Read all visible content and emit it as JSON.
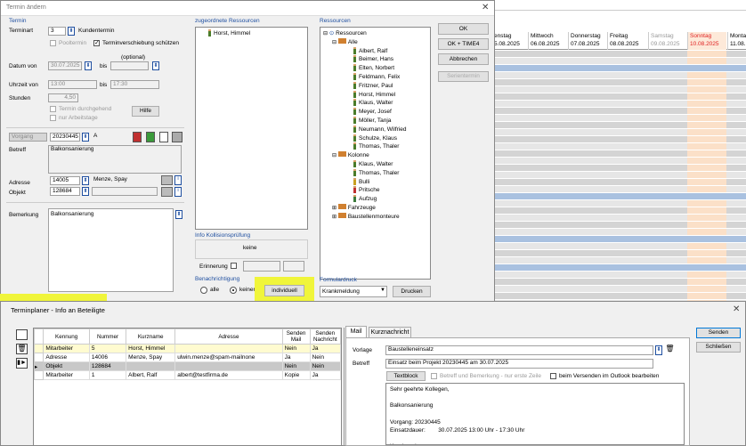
{
  "termin_dialog": {
    "title": "Termin ändern",
    "section_termin": "Termin",
    "terminart_label": "Terminart",
    "terminart_value": "3",
    "terminart_text": "Kundentermin",
    "pooltermin_label": "Pooltermin",
    "verschiebung_label": "Terminverschiebung schützen",
    "optional_label": "(optional)",
    "datum_von_label": "Datum von",
    "datum_von_value": "30.07.2025",
    "bis_label": "bis",
    "uhrzeit_label": "Uhrzeit von",
    "uhrzeit_von": "13:00",
    "uhrzeit_bis": "17:30",
    "stunden_label": "Stunden",
    "stunden_value": "4,50",
    "durchgehend_label": "Termin durchgehend",
    "arbeitstage_label": "nur Arbeitstage",
    "hilfe_label": "Hilfe",
    "vorgang_label": "Vorgang",
    "vorgang_value": "20230445",
    "vorgang_suffix": "A",
    "betreff_label": "Betreff",
    "betreff_value": "Balkonsanierung",
    "adresse_label": "Adresse",
    "adresse_value": "14005",
    "adresse_name": "Menze, Spay",
    "objekt_label": "Objekt",
    "objekt_value": "128684",
    "bemerkung_label": "Bemerkung",
    "bemerkung_value": "Balkonsanierung"
  },
  "zugeordnet": {
    "title": "zugeordnete Ressourcen",
    "items": [
      "Horst, Himmel"
    ]
  },
  "kollision": {
    "title": "Info Kollisionsprüfung",
    "value": "keine"
  },
  "erinnerung_label": "Erinnerung",
  "benachrichtigung": {
    "title": "Benachrichtigung",
    "opt_alle": "alle",
    "opt_keiner": "keiner",
    "individuell": "individuell"
  },
  "ressourcen": {
    "title": "Ressourcen",
    "root": "Ressourcen",
    "alle": "Alle",
    "alle_items": [
      "Albert, Ralf",
      "Beimer, Hans",
      "Elten, Norbert",
      "Feldmann, Felix",
      "Fritzner, Paul",
      "Horst, Himmel",
      "Klaus, Walter",
      "Meyer, Josef",
      "Möller, Tanja",
      "Neumann, Wilfried",
      "Schulze, Klaus",
      "Thomas, Thaler"
    ],
    "kolonne": "Kolonne",
    "kolonne_items": [
      "Klaus, Walter",
      "Thomas, Thaler",
      "Bulli",
      "Pritsche",
      "Aufzug"
    ],
    "fahrzeuge": "Fahrzeuge",
    "baustellenmonteure": "Baustellenmonteure"
  },
  "formulardruck": {
    "title": "Formulardruck",
    "select": "Krankmeldung",
    "drucken": "Drucken"
  },
  "side_buttons": {
    "ok": "OK",
    "ok_time": "OK + TIME4",
    "abbrechen": "Abbrechen",
    "serientermin": "Serientermin"
  },
  "calendar": {
    "days": [
      {
        "name": "enstag",
        "date": "5.08.2025",
        "color": "#000"
      },
      {
        "name": "Mittwoch",
        "date": "06.08.2025",
        "color": "#000"
      },
      {
        "name": "Donnerstag",
        "date": "07.08.2025",
        "color": "#000"
      },
      {
        "name": "Freitag",
        "date": "08.08.2025",
        "color": "#000"
      },
      {
        "name": "Samstag",
        "date": "09.08.2025",
        "color": "#999"
      },
      {
        "name": "Sonntag",
        "date": "10.08.2025",
        "color": "#e02020"
      },
      {
        "name": "Monta",
        "date": "11.08.",
        "color": "#000"
      }
    ]
  },
  "info_dialog": {
    "title": "Terminplaner - Info an Beteiligte",
    "headers": [
      "Kennung",
      "Nummer",
      "Kurzname",
      "Adresse",
      "Senden Mail",
      "Senden Nachricht"
    ],
    "rows": [
      [
        "Mitarbeiter",
        "5",
        "Horst, Himmel",
        "",
        "Nein",
        "Ja"
      ],
      [
        "Adresse",
        "14006",
        "Menze, Spay",
        "ulwin.menze@spam-mailnone",
        "Ja",
        "Nein"
      ],
      [
        "Objekt",
        "128684",
        "",
        "",
        "Nein",
        "Nein"
      ],
      [
        "Mitarbeiter",
        "1",
        "Albert, Ralf",
        "albert@testfirma.de",
        "Kopie",
        "Ja"
      ]
    ],
    "tab_mail": "Mail",
    "tab_kurz": "Kurznachricht",
    "vorlage_label": "Vorlage",
    "vorlage_value": "Baustelleneinsatz",
    "betreff_label": "Betreff",
    "betreff_value": "Einsatz beim Projekt 20230445 am 30.07.2025",
    "textblock": "Textblock",
    "cb1": "Betreff und Bemerkung - nur erste Zeile",
    "cb2": "beim Versenden im Outlook bearbeiten",
    "body_lines": [
      "Sehr geehrte Kollegen,",
      "",
      "Balkonsanierung",
      "",
      "Vorgang: 20230445",
      "Einsatzdauer:        30.07.2025 13:00 Uhr - 17:30 Uhr",
      "",
      "Kundenadresse:"
    ],
    "senden": "Senden",
    "schliessen": "Schließen"
  }
}
